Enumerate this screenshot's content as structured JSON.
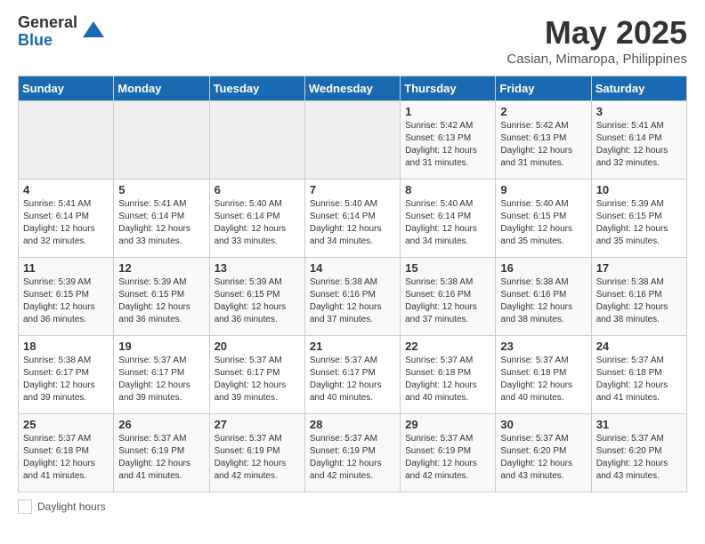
{
  "header": {
    "logo_general": "General",
    "logo_blue": "Blue",
    "title": "May 2025",
    "subtitle": "Casian, Mimaropa, Philippines"
  },
  "weekdays": [
    "Sunday",
    "Monday",
    "Tuesday",
    "Wednesday",
    "Thursday",
    "Friday",
    "Saturday"
  ],
  "weeks": [
    [
      {
        "day": "",
        "info": ""
      },
      {
        "day": "",
        "info": ""
      },
      {
        "day": "",
        "info": ""
      },
      {
        "day": "",
        "info": ""
      },
      {
        "day": "1",
        "info": "Sunrise: 5:42 AM\nSunset: 6:13 PM\nDaylight: 12 hours\nand 31 minutes."
      },
      {
        "day": "2",
        "info": "Sunrise: 5:42 AM\nSunset: 6:13 PM\nDaylight: 12 hours\nand 31 minutes."
      },
      {
        "day": "3",
        "info": "Sunrise: 5:41 AM\nSunset: 6:14 PM\nDaylight: 12 hours\nand 32 minutes."
      }
    ],
    [
      {
        "day": "4",
        "info": "Sunrise: 5:41 AM\nSunset: 6:14 PM\nDaylight: 12 hours\nand 32 minutes."
      },
      {
        "day": "5",
        "info": "Sunrise: 5:41 AM\nSunset: 6:14 PM\nDaylight: 12 hours\nand 33 minutes."
      },
      {
        "day": "6",
        "info": "Sunrise: 5:40 AM\nSunset: 6:14 PM\nDaylight: 12 hours\nand 33 minutes."
      },
      {
        "day": "7",
        "info": "Sunrise: 5:40 AM\nSunset: 6:14 PM\nDaylight: 12 hours\nand 34 minutes."
      },
      {
        "day": "8",
        "info": "Sunrise: 5:40 AM\nSunset: 6:14 PM\nDaylight: 12 hours\nand 34 minutes."
      },
      {
        "day": "9",
        "info": "Sunrise: 5:40 AM\nSunset: 6:15 PM\nDaylight: 12 hours\nand 35 minutes."
      },
      {
        "day": "10",
        "info": "Sunrise: 5:39 AM\nSunset: 6:15 PM\nDaylight: 12 hours\nand 35 minutes."
      }
    ],
    [
      {
        "day": "11",
        "info": "Sunrise: 5:39 AM\nSunset: 6:15 PM\nDaylight: 12 hours\nand 36 minutes."
      },
      {
        "day": "12",
        "info": "Sunrise: 5:39 AM\nSunset: 6:15 PM\nDaylight: 12 hours\nand 36 minutes."
      },
      {
        "day": "13",
        "info": "Sunrise: 5:39 AM\nSunset: 6:15 PM\nDaylight: 12 hours\nand 36 minutes."
      },
      {
        "day": "14",
        "info": "Sunrise: 5:38 AM\nSunset: 6:16 PM\nDaylight: 12 hours\nand 37 minutes."
      },
      {
        "day": "15",
        "info": "Sunrise: 5:38 AM\nSunset: 6:16 PM\nDaylight: 12 hours\nand 37 minutes."
      },
      {
        "day": "16",
        "info": "Sunrise: 5:38 AM\nSunset: 6:16 PM\nDaylight: 12 hours\nand 38 minutes."
      },
      {
        "day": "17",
        "info": "Sunrise: 5:38 AM\nSunset: 6:16 PM\nDaylight: 12 hours\nand 38 minutes."
      }
    ],
    [
      {
        "day": "18",
        "info": "Sunrise: 5:38 AM\nSunset: 6:17 PM\nDaylight: 12 hours\nand 39 minutes."
      },
      {
        "day": "19",
        "info": "Sunrise: 5:37 AM\nSunset: 6:17 PM\nDaylight: 12 hours\nand 39 minutes."
      },
      {
        "day": "20",
        "info": "Sunrise: 5:37 AM\nSunset: 6:17 PM\nDaylight: 12 hours\nand 39 minutes."
      },
      {
        "day": "21",
        "info": "Sunrise: 5:37 AM\nSunset: 6:17 PM\nDaylight: 12 hours\nand 40 minutes."
      },
      {
        "day": "22",
        "info": "Sunrise: 5:37 AM\nSunset: 6:18 PM\nDaylight: 12 hours\nand 40 minutes."
      },
      {
        "day": "23",
        "info": "Sunrise: 5:37 AM\nSunset: 6:18 PM\nDaylight: 12 hours\nand 40 minutes."
      },
      {
        "day": "24",
        "info": "Sunrise: 5:37 AM\nSunset: 6:18 PM\nDaylight: 12 hours\nand 41 minutes."
      }
    ],
    [
      {
        "day": "25",
        "info": "Sunrise: 5:37 AM\nSunset: 6:18 PM\nDaylight: 12 hours\nand 41 minutes."
      },
      {
        "day": "26",
        "info": "Sunrise: 5:37 AM\nSunset: 6:19 PM\nDaylight: 12 hours\nand 41 minutes."
      },
      {
        "day": "27",
        "info": "Sunrise: 5:37 AM\nSunset: 6:19 PM\nDaylight: 12 hours\nand 42 minutes."
      },
      {
        "day": "28",
        "info": "Sunrise: 5:37 AM\nSunset: 6:19 PM\nDaylight: 12 hours\nand 42 minutes."
      },
      {
        "day": "29",
        "info": "Sunrise: 5:37 AM\nSunset: 6:19 PM\nDaylight: 12 hours\nand 42 minutes."
      },
      {
        "day": "30",
        "info": "Sunrise: 5:37 AM\nSunset: 6:20 PM\nDaylight: 12 hours\nand 43 minutes."
      },
      {
        "day": "31",
        "info": "Sunrise: 5:37 AM\nSunset: 6:20 PM\nDaylight: 12 hours\nand 43 minutes."
      }
    ]
  ],
  "footer": {
    "daylight_label": "Daylight hours"
  }
}
